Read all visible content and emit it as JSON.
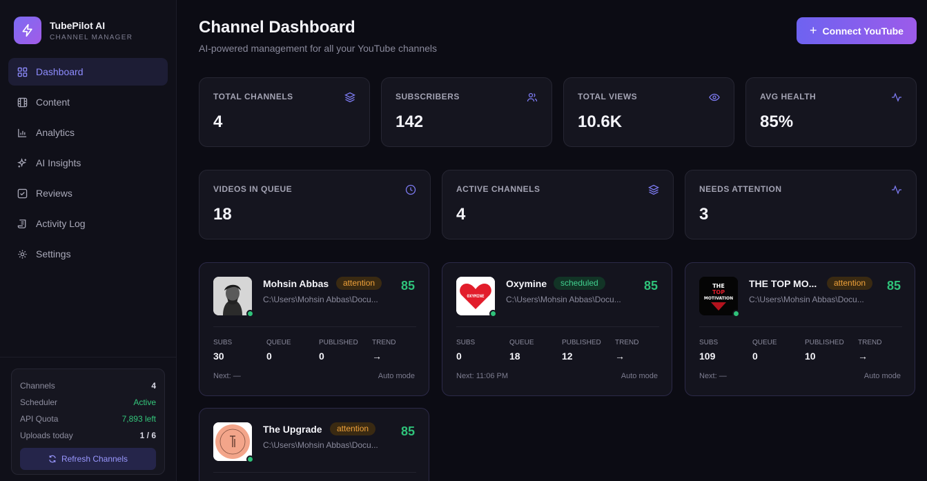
{
  "brand": {
    "title": "TubePilot AI",
    "subtitle": "CHANNEL MANAGER"
  },
  "nav": [
    {
      "label": "Dashboard",
      "icon": "grid-icon",
      "active": true
    },
    {
      "label": "Content",
      "icon": "film-icon"
    },
    {
      "label": "Analytics",
      "icon": "bar-chart-icon"
    },
    {
      "label": "AI Insights",
      "icon": "sparkles-icon"
    },
    {
      "label": "Reviews",
      "icon": "check-square-icon"
    },
    {
      "label": "Activity Log",
      "icon": "scroll-icon"
    },
    {
      "label": "Settings",
      "icon": "gear-icon"
    }
  ],
  "status": {
    "channels_label": "Channels",
    "channels_value": "4",
    "scheduler_label": "Scheduler",
    "scheduler_value": "Active",
    "quota_label": "API Quota",
    "quota_value": "7,893 left",
    "uploads_label": "Uploads today",
    "uploads_value": "1 / 6",
    "refresh_label": "Refresh Channels"
  },
  "header": {
    "title": "Channel Dashboard",
    "subtitle": "AI-powered management for all your YouTube channels",
    "connect_label": "Connect YouTube"
  },
  "stats": [
    {
      "label": "TOTAL CHANNELS",
      "value": "4",
      "icon": "layers-icon"
    },
    {
      "label": "SUBSCRIBERS",
      "value": "142",
      "icon": "users-icon"
    },
    {
      "label": "TOTAL VIEWS",
      "value": "10.6K",
      "icon": "eye-icon"
    },
    {
      "label": "AVG HEALTH",
      "value": "85%",
      "icon": "pulse-icon"
    },
    {
      "label": "VIDEOS IN QUEUE",
      "value": "18",
      "icon": "clock-icon"
    },
    {
      "label": "ACTIVE CHANNELS",
      "value": "4",
      "icon": "layers-icon"
    },
    {
      "label": "NEEDS ATTENTION",
      "value": "3",
      "icon": "pulse-icon"
    }
  ],
  "metric_labels": {
    "subs": "SUBS",
    "queue": "QUEUE",
    "published": "PUBLISHED",
    "trend": "TREND"
  },
  "channels": [
    {
      "name": "Mohsin Abbas",
      "badge": "attention",
      "path": "C:\\Users\\Mohsin Abbas\\Docu...",
      "score": "85",
      "subs": "30",
      "queue": "0",
      "published": "0",
      "trend": "→",
      "next": "Next: —",
      "mode": "Auto mode"
    },
    {
      "name": "Oxymine",
      "badge": "scheduled",
      "path": "C:\\Users\\Mohsin Abbas\\Docu...",
      "score": "85",
      "subs": "0",
      "queue": "18",
      "published": "12",
      "trend": "→",
      "next": "Next: 11:06 PM",
      "mode": "Auto mode",
      "logo_text": "OXYMINE"
    },
    {
      "name": "THE TOP MO...",
      "badge": "attention",
      "path": "C:\\Users\\Mohsin Abbas\\Docu...",
      "score": "85",
      "subs": "109",
      "queue": "0",
      "published": "10",
      "trend": "→",
      "next": "Next: —",
      "mode": "Auto mode",
      "logo_lines": [
        "THE",
        "TOP",
        "MOTIVATION"
      ]
    },
    {
      "name": "The Upgrade",
      "badge": "attention",
      "path": "C:\\Users\\Mohsin Abbas\\Docu...",
      "score": "85"
    }
  ],
  "colors": {
    "accent": "#8e8cff",
    "green": "#2fc27a",
    "attention": "#f0a23a"
  }
}
